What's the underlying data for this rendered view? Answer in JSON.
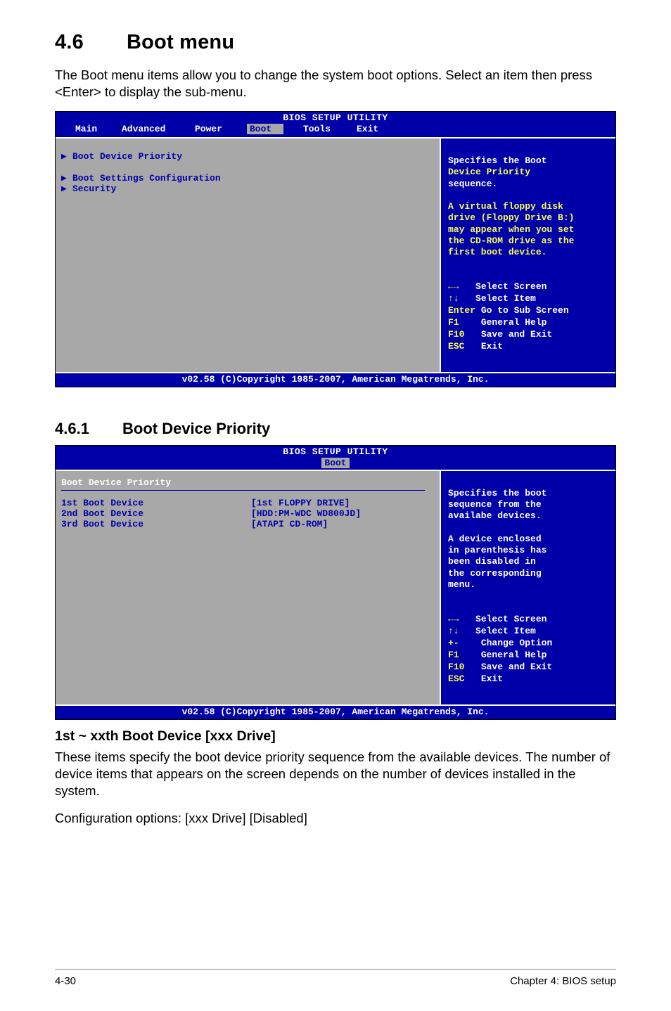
{
  "section": {
    "number": "4.6",
    "title": "Boot menu",
    "intro": "The Boot menu items allow you to change the system boot options. Select an item then press <Enter> to display the sub-menu."
  },
  "bios1": {
    "title": "BIOS SETUP UTILITY",
    "tabs": {
      "main": "Main",
      "advanced": "Advanced",
      "power": "Power",
      "boot": "Boot",
      "tools": "Tools",
      "exit": "Exit"
    },
    "items": {
      "boot_device_priority": "Boot Device Priority",
      "boot_settings_config": "Boot Settings Configuration",
      "security": "Security"
    },
    "help": {
      "l1": "Specifies the Boot",
      "l2": "Device Priority",
      "l3": "sequence.",
      "l4": "A virtual floppy disk",
      "l5": "drive (Floppy Drive B:)",
      "l6": "may appear when you set",
      "l7": "the CD-ROM drive as the",
      "l8": "first boot device."
    },
    "nav": {
      "select_screen": "Select Screen",
      "select_item": "Select Item",
      "enter": "Enter",
      "enter_txt": "Go to Sub Screen",
      "f1": "F1",
      "f1_txt": "General Help",
      "f10": "F10",
      "f10_txt": "Save and Exit",
      "esc": "ESC",
      "esc_txt": "Exit"
    },
    "copyright": "v02.58 (C)Copyright 1985-2007, American Megatrends, Inc."
  },
  "subsection": {
    "number": "4.6.1",
    "title": "Boot Device Priority"
  },
  "bios2": {
    "title": "BIOS SETUP UTILITY",
    "tab": "Boot",
    "heading": "Boot Device Priority",
    "rows": {
      "r1_label": "1st Boot Device",
      "r1_val": "[1st FLOPPY DRIVE]",
      "r2_label": "2nd Boot Device",
      "r2_val": "[HDD:PM-WDC WD800JD]",
      "r3_label": "3rd Boot Device",
      "r3_val": "[ATAPI CD-ROM]"
    },
    "help": {
      "l1": "Specifies the boot",
      "l2": "sequence from the",
      "l3": "availabe devices.",
      "l4": "A device enclosed",
      "l5": "in parenthesis has",
      "l6": "been disabled in",
      "l7": "the corresponding",
      "l8": "menu."
    },
    "nav": {
      "select_screen": "Select Screen",
      "select_item": "Select Item",
      "pm": "+-",
      "pm_txt": "Change Option",
      "f1": "F1",
      "f1_txt": "General Help",
      "f10": "F10",
      "f10_txt": "Save and Exit",
      "esc": "ESC",
      "esc_txt": "Exit"
    },
    "copyright": "v02.58 (C)Copyright 1985-2007, American Megatrends, Inc."
  },
  "item": {
    "heading": "1st ~ xxth Boot Device [xxx Drive]",
    "p1": "These items specify the boot device priority sequence from the available devices. The number of device items that appears on the screen depends on the number of devices installed in the system.",
    "p2": "Configuration options: [xxx Drive] [Disabled]"
  },
  "footer": {
    "left": "4-30",
    "right": "Chapter 4: BIOS setup"
  }
}
